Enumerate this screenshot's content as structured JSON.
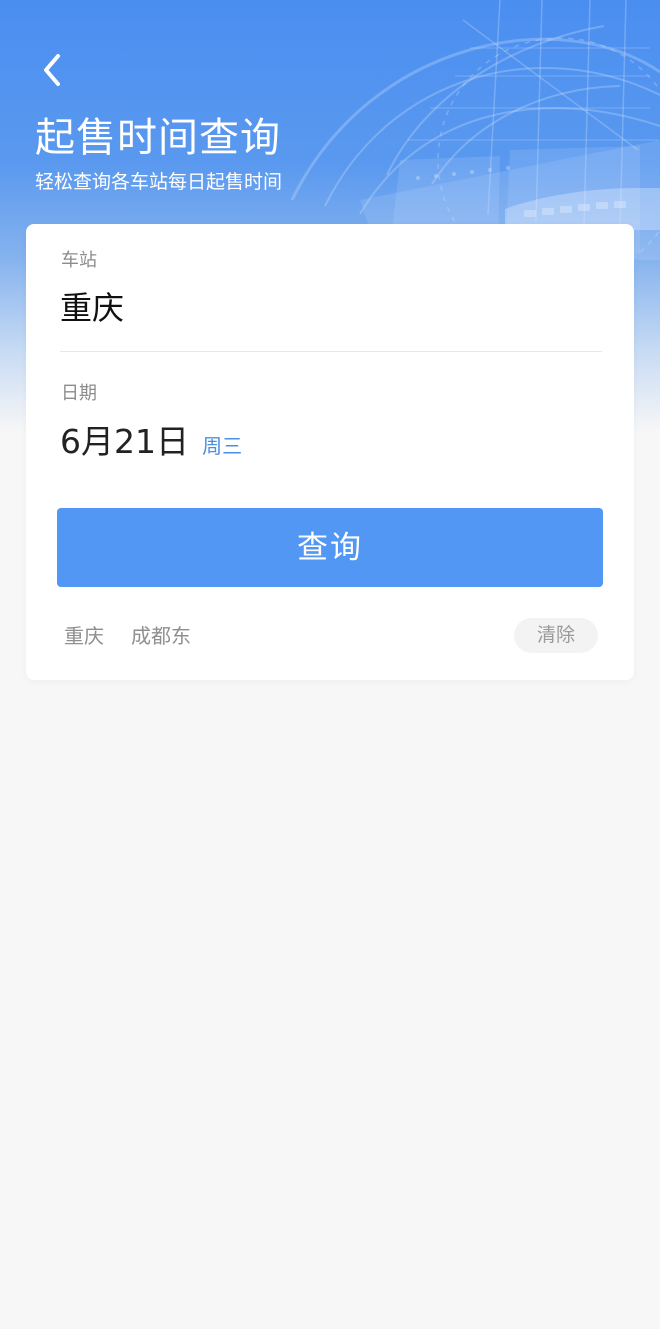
{
  "header": {
    "back_icon": "chevron-left-icon",
    "title": "起售时间查询",
    "subtitle": "轻松查询各车站每日起售时间"
  },
  "form": {
    "station_label": "车站",
    "station_value": "重庆",
    "date_label": "日期",
    "date_value": "6月21日",
    "weekday": "周三",
    "submit_label": "查询"
  },
  "history": {
    "items": [
      "重庆",
      "成都东"
    ],
    "clear_label": "清除"
  },
  "colors": {
    "accent": "#5297f3",
    "header_blue": "#4a8ef0",
    "weekday_blue": "#4a90e2",
    "background": "#f7f7f7"
  }
}
